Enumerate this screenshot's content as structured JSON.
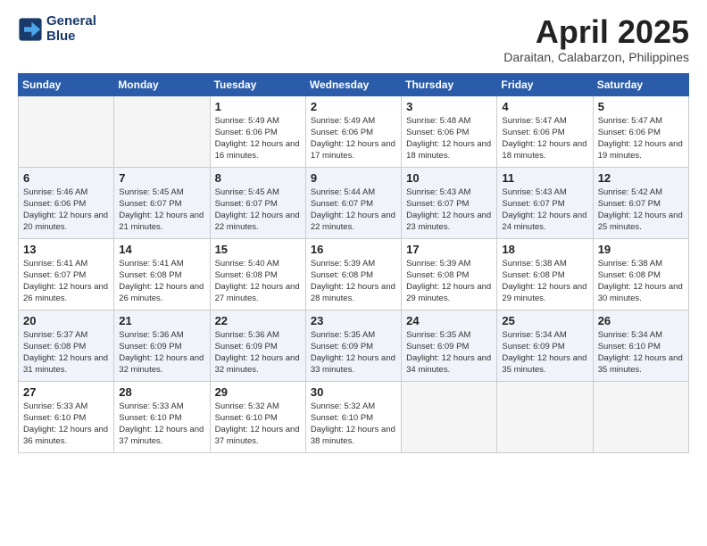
{
  "header": {
    "logo_line1": "General",
    "logo_line2": "Blue",
    "month": "April 2025",
    "location": "Daraitan, Calabarzon, Philippines"
  },
  "weekdays": [
    "Sunday",
    "Monday",
    "Tuesday",
    "Wednesday",
    "Thursday",
    "Friday",
    "Saturday"
  ],
  "weeks": [
    [
      {
        "day": "",
        "empty": true
      },
      {
        "day": "",
        "empty": true
      },
      {
        "day": "1",
        "sunrise": "5:49 AM",
        "sunset": "6:06 PM",
        "daylight": "12 hours and 16 minutes."
      },
      {
        "day": "2",
        "sunrise": "5:49 AM",
        "sunset": "6:06 PM",
        "daylight": "12 hours and 17 minutes."
      },
      {
        "day": "3",
        "sunrise": "5:48 AM",
        "sunset": "6:06 PM",
        "daylight": "12 hours and 18 minutes."
      },
      {
        "day": "4",
        "sunrise": "5:47 AM",
        "sunset": "6:06 PM",
        "daylight": "12 hours and 18 minutes."
      },
      {
        "day": "5",
        "sunrise": "5:47 AM",
        "sunset": "6:06 PM",
        "daylight": "12 hours and 19 minutes."
      }
    ],
    [
      {
        "day": "6",
        "sunrise": "5:46 AM",
        "sunset": "6:06 PM",
        "daylight": "12 hours and 20 minutes."
      },
      {
        "day": "7",
        "sunrise": "5:45 AM",
        "sunset": "6:07 PM",
        "daylight": "12 hours and 21 minutes."
      },
      {
        "day": "8",
        "sunrise": "5:45 AM",
        "sunset": "6:07 PM",
        "daylight": "12 hours and 22 minutes."
      },
      {
        "day": "9",
        "sunrise": "5:44 AM",
        "sunset": "6:07 PM",
        "daylight": "12 hours and 22 minutes."
      },
      {
        "day": "10",
        "sunrise": "5:43 AM",
        "sunset": "6:07 PM",
        "daylight": "12 hours and 23 minutes."
      },
      {
        "day": "11",
        "sunrise": "5:43 AM",
        "sunset": "6:07 PM",
        "daylight": "12 hours and 24 minutes."
      },
      {
        "day": "12",
        "sunrise": "5:42 AM",
        "sunset": "6:07 PM",
        "daylight": "12 hours and 25 minutes."
      }
    ],
    [
      {
        "day": "13",
        "sunrise": "5:41 AM",
        "sunset": "6:07 PM",
        "daylight": "12 hours and 26 minutes."
      },
      {
        "day": "14",
        "sunrise": "5:41 AM",
        "sunset": "6:08 PM",
        "daylight": "12 hours and 26 minutes."
      },
      {
        "day": "15",
        "sunrise": "5:40 AM",
        "sunset": "6:08 PM",
        "daylight": "12 hours and 27 minutes."
      },
      {
        "day": "16",
        "sunrise": "5:39 AM",
        "sunset": "6:08 PM",
        "daylight": "12 hours and 28 minutes."
      },
      {
        "day": "17",
        "sunrise": "5:39 AM",
        "sunset": "6:08 PM",
        "daylight": "12 hours and 29 minutes."
      },
      {
        "day": "18",
        "sunrise": "5:38 AM",
        "sunset": "6:08 PM",
        "daylight": "12 hours and 29 minutes."
      },
      {
        "day": "19",
        "sunrise": "5:38 AM",
        "sunset": "6:08 PM",
        "daylight": "12 hours and 30 minutes."
      }
    ],
    [
      {
        "day": "20",
        "sunrise": "5:37 AM",
        "sunset": "6:08 PM",
        "daylight": "12 hours and 31 minutes."
      },
      {
        "day": "21",
        "sunrise": "5:36 AM",
        "sunset": "6:09 PM",
        "daylight": "12 hours and 32 minutes."
      },
      {
        "day": "22",
        "sunrise": "5:36 AM",
        "sunset": "6:09 PM",
        "daylight": "12 hours and 32 minutes."
      },
      {
        "day": "23",
        "sunrise": "5:35 AM",
        "sunset": "6:09 PM",
        "daylight": "12 hours and 33 minutes."
      },
      {
        "day": "24",
        "sunrise": "5:35 AM",
        "sunset": "6:09 PM",
        "daylight": "12 hours and 34 minutes."
      },
      {
        "day": "25",
        "sunrise": "5:34 AM",
        "sunset": "6:09 PM",
        "daylight": "12 hours and 35 minutes."
      },
      {
        "day": "26",
        "sunrise": "5:34 AM",
        "sunset": "6:10 PM",
        "daylight": "12 hours and 35 minutes."
      }
    ],
    [
      {
        "day": "27",
        "sunrise": "5:33 AM",
        "sunset": "6:10 PM",
        "daylight": "12 hours and 36 minutes."
      },
      {
        "day": "28",
        "sunrise": "5:33 AM",
        "sunset": "6:10 PM",
        "daylight": "12 hours and 37 minutes."
      },
      {
        "day": "29",
        "sunrise": "5:32 AM",
        "sunset": "6:10 PM",
        "daylight": "12 hours and 37 minutes."
      },
      {
        "day": "30",
        "sunrise": "5:32 AM",
        "sunset": "6:10 PM",
        "daylight": "12 hours and 38 minutes."
      },
      {
        "day": "",
        "empty": true
      },
      {
        "day": "",
        "empty": true
      },
      {
        "day": "",
        "empty": true
      }
    ]
  ]
}
